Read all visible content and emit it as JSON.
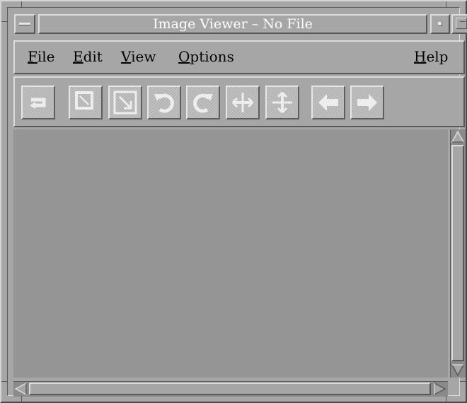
{
  "window": {
    "title": "Image Viewer – No File"
  },
  "menubar": {
    "items": [
      {
        "label": "File",
        "mnemonic": "F",
        "rest": "ile"
      },
      {
        "label": "Edit",
        "mnemonic": "E",
        "rest": "dit"
      },
      {
        "label": "View",
        "mnemonic": "V",
        "rest": "iew"
      },
      {
        "label": "Options",
        "mnemonic": "O",
        "rest": "ptions"
      },
      {
        "label": "Help",
        "mnemonic": "H",
        "rest": "elp"
      }
    ]
  },
  "toolbar": {
    "buttons": [
      {
        "name": "restore-icon"
      },
      {
        "name": "zoom-fit-icon"
      },
      {
        "name": "zoom-area-icon"
      },
      {
        "name": "rotate-left-icon"
      },
      {
        "name": "rotate-right-icon"
      },
      {
        "name": "flip-horizontal-icon"
      },
      {
        "name": "flip-vertical-icon"
      },
      {
        "name": "previous-arrow-icon"
      },
      {
        "name": "next-arrow-icon"
      }
    ]
  },
  "colors": {
    "background": "#a6a6a6",
    "viewport": "#959595",
    "title_text": "#ffffff"
  }
}
